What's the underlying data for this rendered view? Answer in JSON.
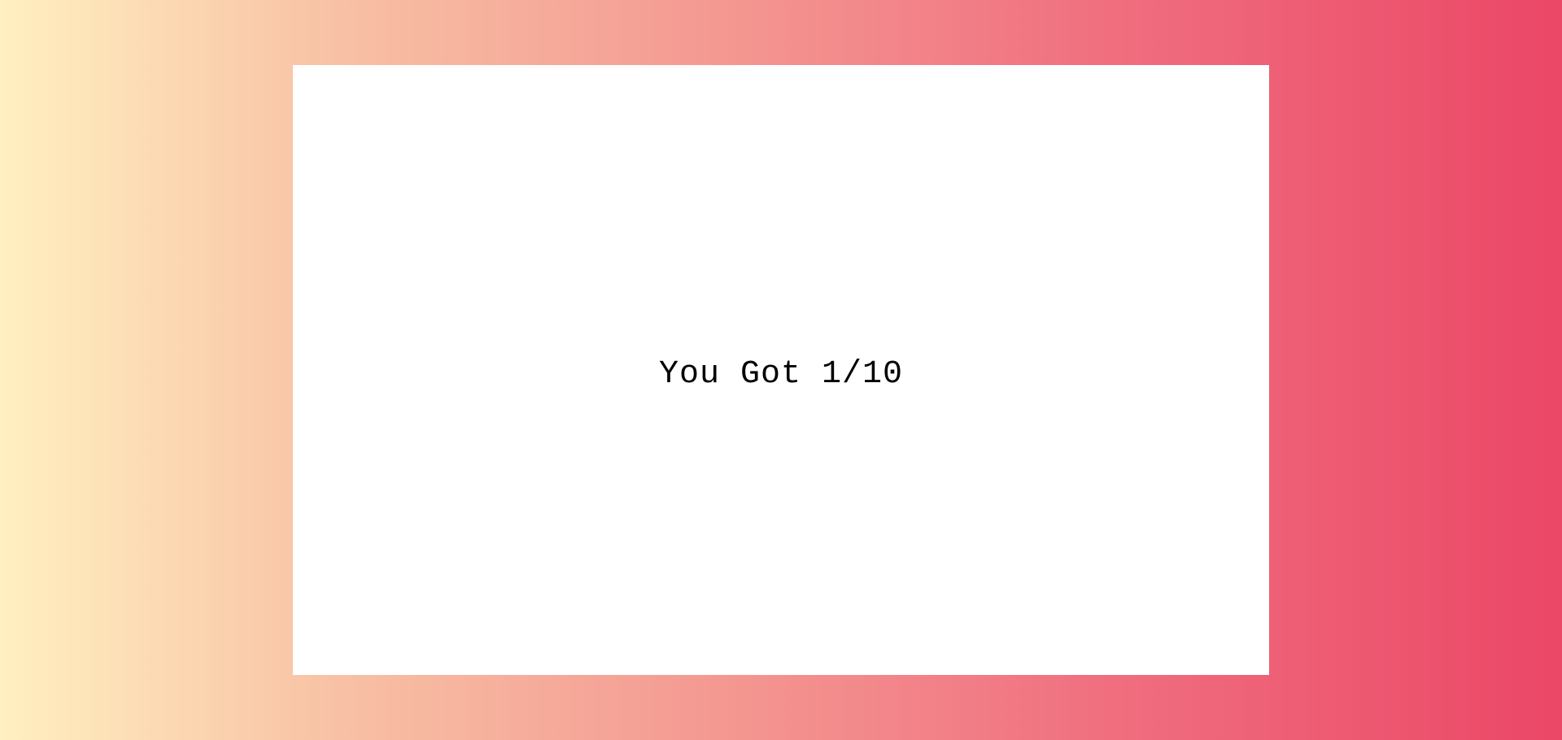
{
  "result": {
    "text": "You Got 1/10",
    "score": 1,
    "total": 10
  },
  "colors": {
    "gradient_start": "#fff0c0",
    "gradient_end": "#eb4766",
    "card_background": "#ffffff",
    "text": "#000000"
  }
}
